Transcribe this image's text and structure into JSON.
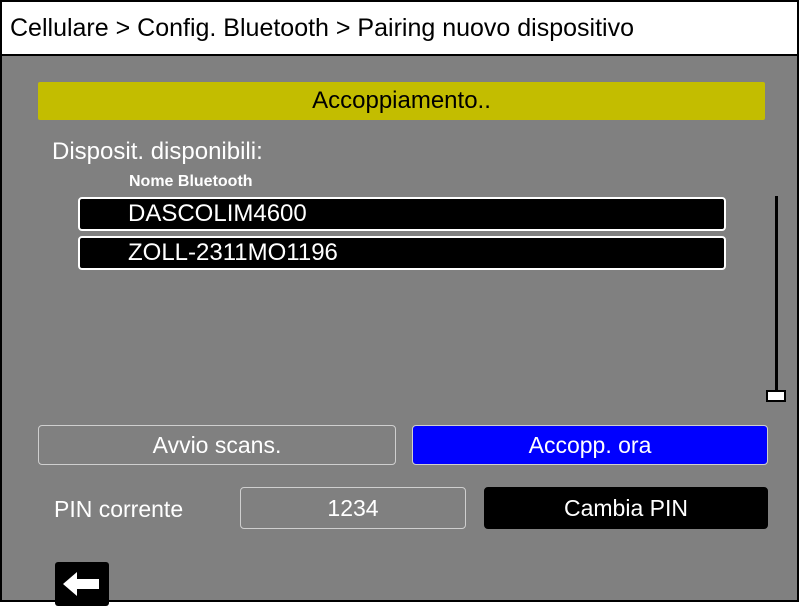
{
  "header": {
    "breadcrumb": "Cellulare > Config. Bluetooth > Pairing nuovo dispositivo"
  },
  "status": {
    "text": "Accoppiamento.."
  },
  "devices": {
    "section_label": "Disposit. disponibili:",
    "column_header": "Nome Bluetooth",
    "items": [
      {
        "name": "DASCOLIM4600"
      },
      {
        "name": "ZOLL-2311MO1196"
      }
    ]
  },
  "actions": {
    "scan_label": "Avvio scans.",
    "pair_label": "Accopp. ora"
  },
  "pin": {
    "label": "PIN corrente",
    "value": "1234",
    "change_label": "Cambia PIN"
  },
  "navigation": {
    "back_icon": "arrow-left-icon"
  },
  "colors": {
    "background": "#808080",
    "status_bar": "#c3bd00",
    "primary_button": "#0000ff",
    "list_item": "#000000"
  }
}
